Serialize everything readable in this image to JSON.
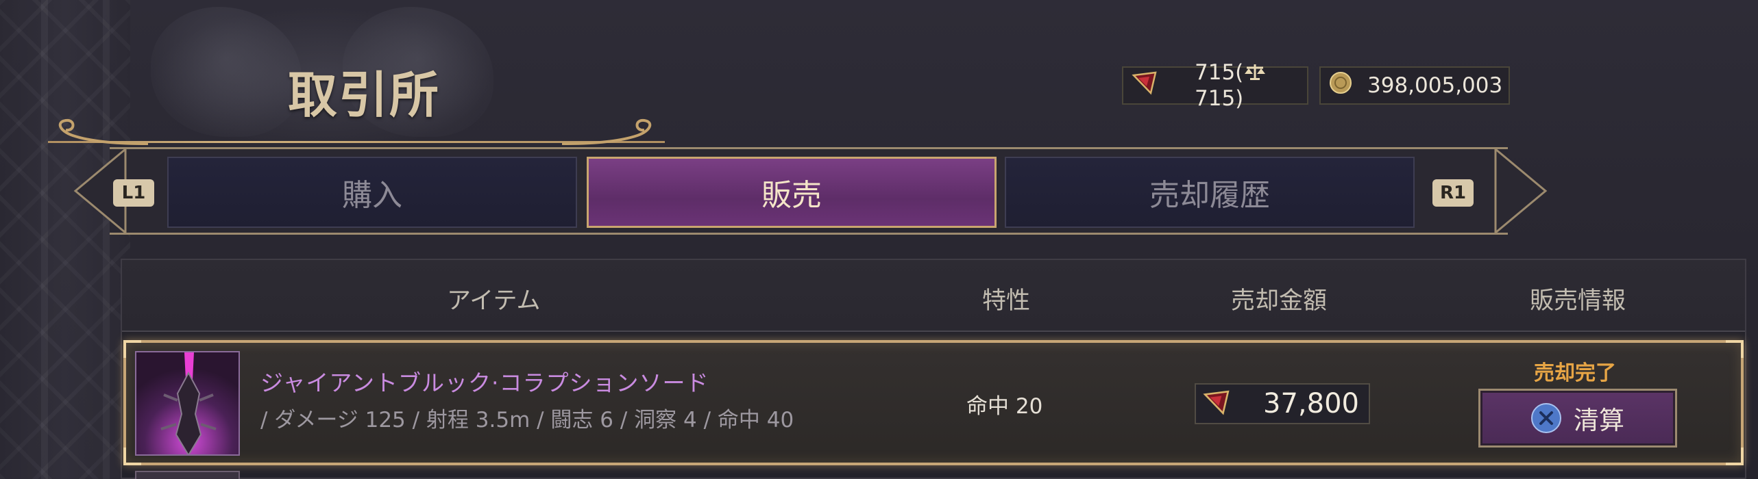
{
  "page_title": "取引所",
  "currency": {
    "gem_amount": "715",
    "gem_tradeable": "715",
    "gold_amount": "398,005,003"
  },
  "tabs": {
    "left_bumper": "L1",
    "right_bumper": "R1",
    "items": [
      {
        "label": "購入",
        "active": false
      },
      {
        "label": "販売",
        "active": true
      },
      {
        "label": "売却履歴",
        "active": false
      }
    ]
  },
  "table": {
    "headers": {
      "item": "アイテム",
      "trait": "特性",
      "price": "売却金額",
      "info": "販売情報"
    },
    "rows": [
      {
        "name": "ジャイアントブルック·コラプションソード",
        "stats": "/ ダメージ 125 / 射程 3.5m / 闘志 6 / 洞察 4 / 命中 40",
        "trait": "命中 20",
        "price": "37,800",
        "status": "売却完了",
        "action": "清算"
      }
    ]
  },
  "colors": {
    "accent_gold": "#c8a676",
    "active_tab": "#7a3f84",
    "item_name": "#c98be0",
    "status_orange": "#e7a545"
  },
  "icons": [
    "gem-icon",
    "scale-icon",
    "gold-coin-icon",
    "cross-button-icon"
  ]
}
